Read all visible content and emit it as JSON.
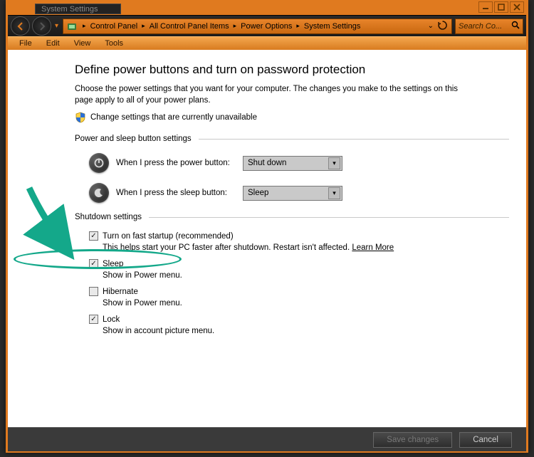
{
  "title": "System Settings",
  "breadcrumbs": [
    "Control Panel",
    "All Control Panel Items",
    "Power Options",
    "System Settings"
  ],
  "search_placeholder": "Search Co...",
  "menus": {
    "file": "File",
    "edit": "Edit",
    "view": "View",
    "tools": "Tools"
  },
  "heading": "Define power buttons and turn on password protection",
  "description": "Choose the power settings that you want for your computer. The changes you make to the settings on this page apply to all of your power plans.",
  "change_link": "Change settings that are currently unavailable",
  "sections": {
    "power_sleep": "Power and sleep button settings",
    "shutdown": "Shutdown settings"
  },
  "options": {
    "power_btn": {
      "label": "When I press the power button:",
      "value": "Shut down"
    },
    "sleep_btn": {
      "label": "When I press the sleep button:",
      "value": "Sleep"
    }
  },
  "shutdown": {
    "fast": {
      "label": "Turn on fast startup (recommended)",
      "checked": true,
      "sub": "This helps start your PC faster after shutdown. Restart isn't affected.",
      "learn": "Learn More"
    },
    "sleep": {
      "label": "Sleep",
      "checked": true,
      "sub": "Show in Power menu."
    },
    "hiber": {
      "label": "Hibernate",
      "checked": false,
      "sub": "Show in Power menu."
    },
    "lock": {
      "label": "Lock",
      "checked": true,
      "sub": "Show in account picture menu."
    }
  },
  "buttons": {
    "save": "Save changes",
    "cancel": "Cancel"
  }
}
